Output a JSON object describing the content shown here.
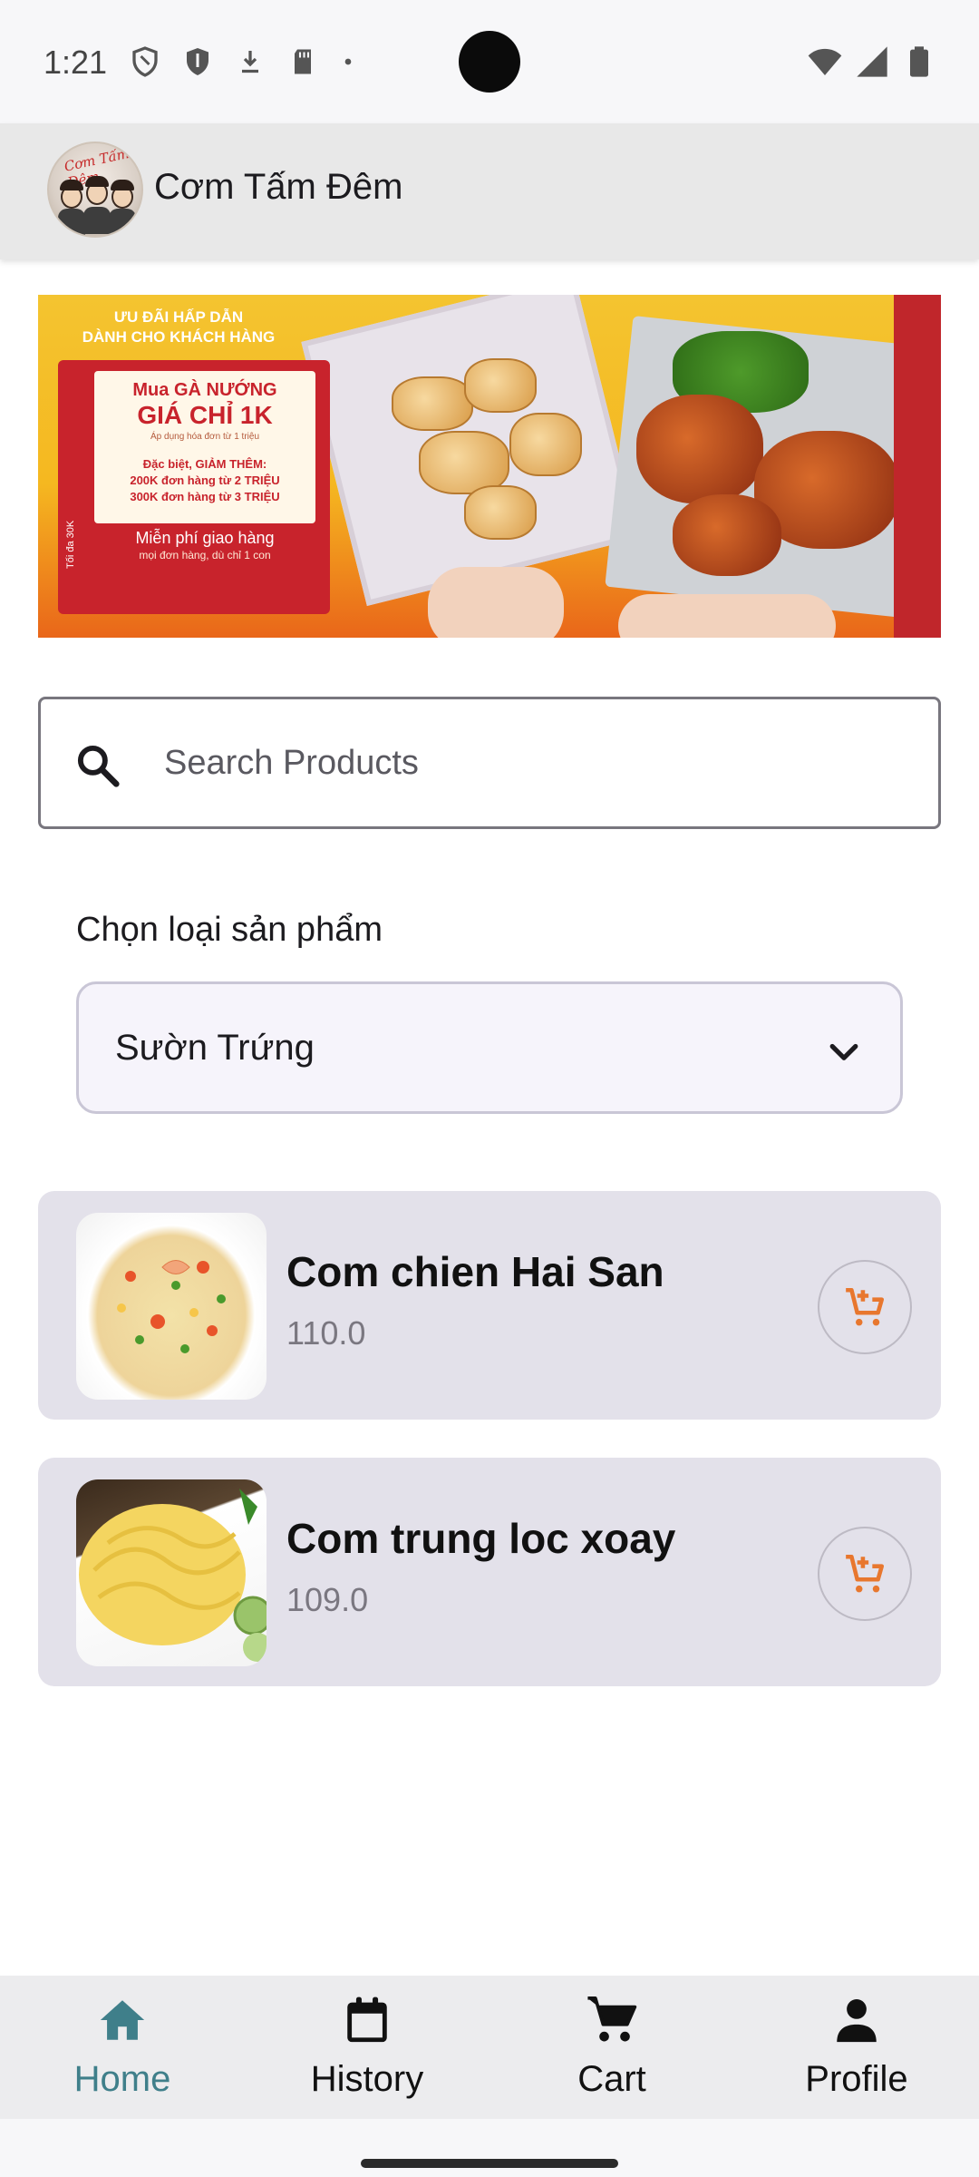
{
  "status_bar": {
    "time": "1:21",
    "left_icons": [
      "shield-outline-icon",
      "shield-filled-icon",
      "download-icon",
      "sd-card-icon",
      "dot-icon"
    ],
    "right_icons": [
      "wifi-icon",
      "signal-icon",
      "battery-icon"
    ]
  },
  "app_bar": {
    "title": "Cơm Tấm Đêm",
    "logo_text": "Cơm Tấm Đêm"
  },
  "banner": {
    "headline": "ƯU ĐÃI HẤP DẪN\nDÀNH CHO KHÁCH HÀNG",
    "offer_line1": "Mua GÀ NƯỚNG",
    "offer_line2": "GIÁ CHỈ 1K",
    "offer_note": "Áp dụng hóa đơn từ 1 triệu",
    "offer_extra": "Đặc biệt, GIẢM THÊM:\n200K đơn hàng từ 2 TRIỆU\n300K đơn hàng từ 3 TRIỆU",
    "shipping_title": "Miễn phí giao hàng",
    "shipping_note": "mọi đơn hàng, dù chỉ 1 con",
    "side_note": "Tối đa 30K"
  },
  "search": {
    "placeholder": "Search Products",
    "value": ""
  },
  "category": {
    "label": "Chọn loại sản phẩm",
    "selected": "Sườn Trứng"
  },
  "products": [
    {
      "name": "Com chien Hai San",
      "price": "110.0"
    },
    {
      "name": "Com trung loc xoay",
      "price": "109.0"
    }
  ],
  "bottom_nav": {
    "items": [
      {
        "label": "Home",
        "icon": "home-icon",
        "active": true
      },
      {
        "label": "History",
        "icon": "calendar-icon",
        "active": false
      },
      {
        "label": "Cart",
        "icon": "cart-icon",
        "active": false
      },
      {
        "label": "Profile",
        "icon": "person-icon",
        "active": false
      }
    ]
  },
  "colors": {
    "accent_active": "#3f7f8a",
    "cart_icon": "#e8772e",
    "card_bg": "#e3e1ea",
    "app_bar_bg": "#e8e8e8"
  }
}
